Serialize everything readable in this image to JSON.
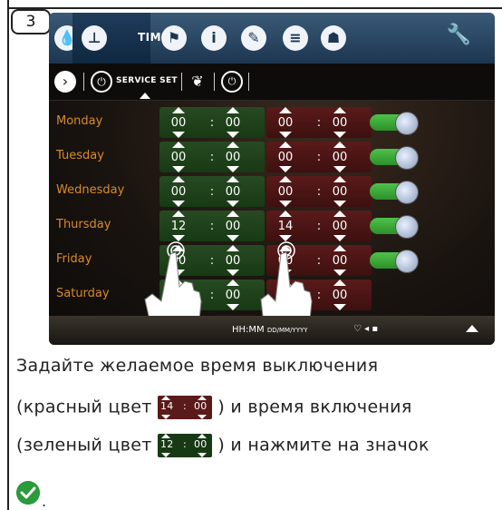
{
  "step": "3",
  "topbar": {
    "time_label": "TIME"
  },
  "subbar": {
    "service_label": "SERVICE SET"
  },
  "days": [
    {
      "name": "Monday",
      "on_h": "00",
      "on_m": "00",
      "off_h": "00",
      "off_m": "00"
    },
    {
      "name": "Tuesday",
      "on_h": "00",
      "on_m": "00",
      "off_h": "00",
      "off_m": "00"
    },
    {
      "name": "Wednesday",
      "on_h": "00",
      "on_m": "00",
      "off_h": "00",
      "off_m": "00"
    },
    {
      "name": "Thursday",
      "on_h": "12",
      "on_m": "00",
      "off_h": "14",
      "off_m": "00"
    },
    {
      "name": "Friday",
      "on_h": "00",
      "on_m": "00",
      "off_h": "00",
      "off_m": "00"
    },
    {
      "name": "Saturday",
      "on_h": "00",
      "on_m": "00",
      "off_h": "00",
      "off_m": "00"
    }
  ],
  "time_separator": ":",
  "bottombar": {
    "time_format": "HH:MM",
    "date_format": "DD/MM/YYYY"
  },
  "caption": {
    "line1": "Задайте желаемое время выключения",
    "line2_a": "(красный цвет",
    "line2_b": ") и время включения",
    "line3_a": "(зеленый цвет",
    "line3_b": ") и нажмите на значок",
    "end": ".",
    "red_example": {
      "h": "14",
      "m": "00"
    },
    "green_example": {
      "h": "12",
      "m": "00"
    }
  },
  "colors": {
    "accent_green": "#2e8f2a",
    "accent_red": "#5a1a1a",
    "day_text": "#d88b2a",
    "topbar": "#1d3650"
  }
}
